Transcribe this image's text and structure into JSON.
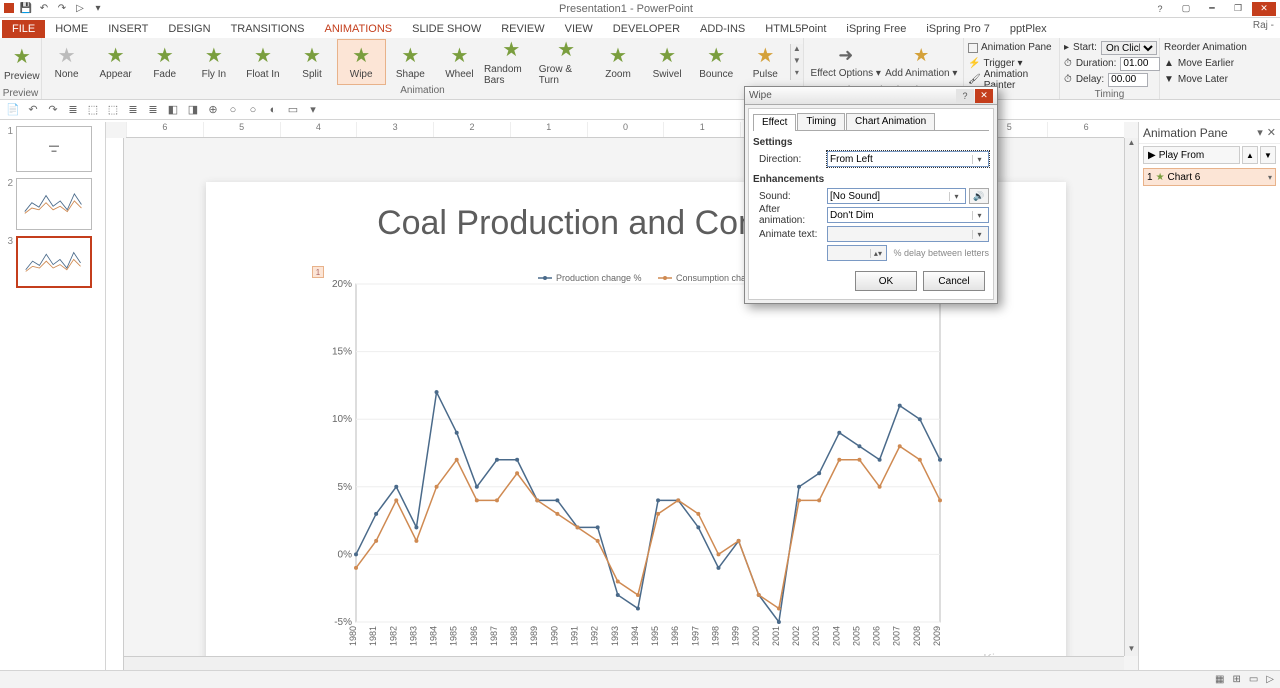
{
  "app_title": "Presentation1 - PowerPoint",
  "user": "Raj -",
  "tabs": [
    "FILE",
    "HOME",
    "INSERT",
    "DESIGN",
    "TRANSITIONS",
    "ANIMATIONS",
    "SLIDE SHOW",
    "REVIEW",
    "VIEW",
    "DEVELOPER",
    "ADD-INS",
    "HTML5Point",
    "iSpring Free",
    "iSpring Pro 7",
    "pptPlex"
  ],
  "active_tab": "ANIMATIONS",
  "ribbon": {
    "preview": "Preview",
    "preview_group": "Preview",
    "animations": [
      "None",
      "Appear",
      "Fade",
      "Fly In",
      "Float In",
      "Split",
      "Wipe",
      "Shape",
      "Wheel",
      "Random Bars",
      "Grow & Turn",
      "Zoom",
      "Swivel",
      "Bounce",
      "Pulse"
    ],
    "selected_anim": "Wipe",
    "animation_group": "Animation",
    "effect_options": "Effect Options ▾",
    "add_anim": "Add Animation ▾",
    "anim_pane": "Animation Pane",
    "trigger": "Trigger ▾",
    "anim_painter": "Animation Painter",
    "adv_group": "Advanced Animation",
    "start_lbl": "Start:",
    "start_val": "On Click",
    "duration_lbl": "Duration:",
    "duration_val": "01.00",
    "delay_lbl": "Delay:",
    "delay_val": "00.00",
    "timing_group": "Timing",
    "reorder": "Reorder Animation",
    "move_earlier": "Move Earlier",
    "move_later": "Move Later"
  },
  "ruler_marks": [
    "6",
    "5",
    "4",
    "3",
    "2",
    "1",
    "0",
    "1",
    "2",
    "3",
    "4",
    "5",
    "6"
  ],
  "slide": {
    "title": "Coal Production and Consumption",
    "tag": "1",
    "watermark": "Kizee.com",
    "legend1": "Production change %",
    "legend2": "Consumption change %"
  },
  "dialog": {
    "title": "Wipe",
    "tabs": [
      "Effect",
      "Timing",
      "Chart Animation"
    ],
    "active_tab": "Effect",
    "settings": "Settings",
    "direction_lbl": "Direction:",
    "direction_val": "From Left",
    "enhancements": "Enhancements",
    "sound_lbl": "Sound:",
    "sound_val": "[No Sound]",
    "after_lbl": "After animation:",
    "after_val": "Don't Dim",
    "animtext_lbl": "Animate text:",
    "animtext_val": "",
    "delay_txt": "% delay between letters",
    "ok": "OK",
    "cancel": "Cancel"
  },
  "anim_pane": {
    "title": "Animation Pane",
    "play": "Play From",
    "item_num": "1",
    "item_name": "Chart 6"
  },
  "thumbs": [
    "1",
    "2",
    "3"
  ],
  "chart_data": {
    "type": "line",
    "title": "Coal Production and Consumption",
    "xlabel": "",
    "ylabel": "",
    "ylim": [
      -5,
      20
    ],
    "yticks": [
      "-5%",
      "0%",
      "5%",
      "10%",
      "15%",
      "20%"
    ],
    "categories": [
      "1980",
      "1981",
      "1982",
      "1983",
      "1984",
      "1985",
      "1986",
      "1987",
      "1988",
      "1989",
      "1990",
      "1991",
      "1992",
      "1993",
      "1994",
      "1995",
      "1996",
      "1997",
      "1998",
      "1999",
      "2000",
      "2001",
      "2002",
      "2003",
      "2004",
      "2005",
      "2006",
      "2007",
      "2008",
      "2009"
    ],
    "series": [
      {
        "name": "Production change %",
        "color": "#4a6a8a",
        "values": [
          0,
          3,
          5,
          2,
          12,
          9,
          5,
          7,
          7,
          4,
          4,
          2,
          2,
          -3,
          -4,
          4,
          4,
          2,
          -1,
          1,
          -3,
          -5,
          5,
          6,
          9,
          8,
          7,
          11,
          10,
          7
        ]
      },
      {
        "name": "Consumption change %",
        "color": "#cf8a52",
        "values": [
          -1,
          1,
          4,
          1,
          5,
          7,
          4,
          4,
          6,
          4,
          3,
          2,
          1,
          -2,
          -3,
          3,
          4,
          3,
          0,
          1,
          -3,
          -4,
          4,
          4,
          7,
          7,
          5,
          8,
          7,
          4
        ]
      }
    ]
  }
}
